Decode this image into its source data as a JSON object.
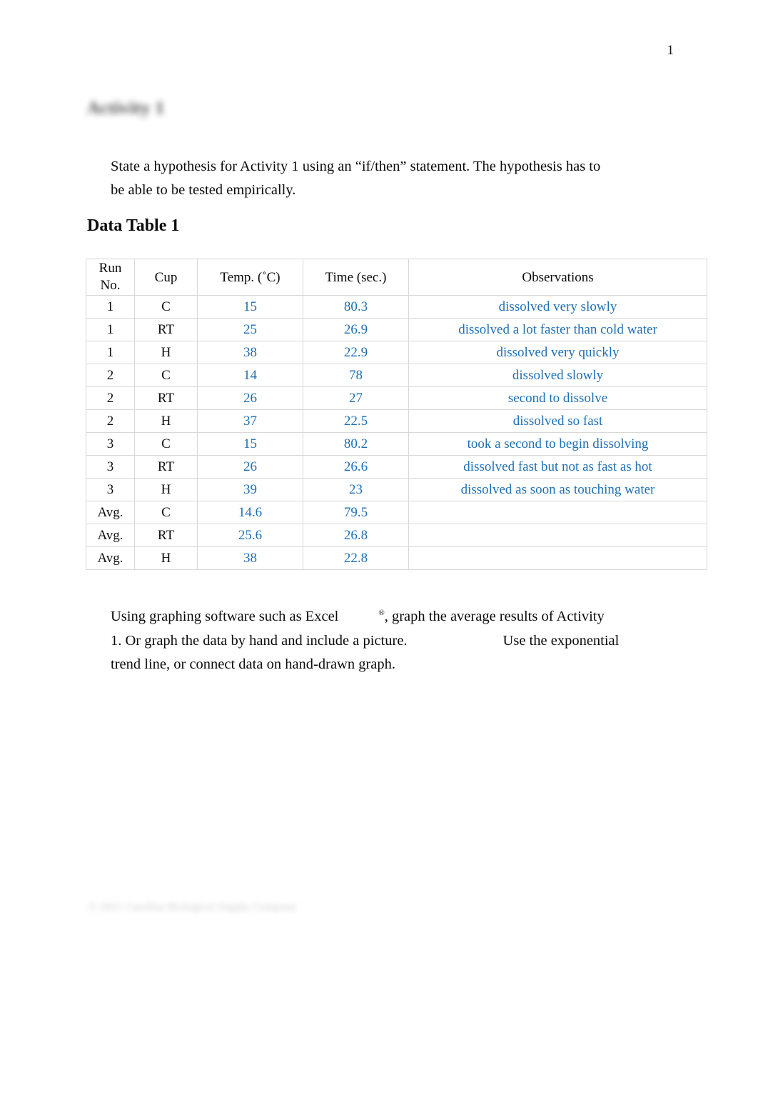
{
  "document": {
    "page_number": "1",
    "activity_title": "Activity 1",
    "hypothesis_text": "State a hypothesis for Activity 1 using an “if/then” statement. The hypothesis has to be able to be tested empirically.",
    "data_table_heading": "Data Table 1",
    "footer_note": "© 2021 Carolina Biological Supply Company",
    "accent_color": "#1f6fb5",
    "text_color": "#0b0b0b"
  },
  "instructions": {
    "line1_a": "Using graphing software such as Excel",
    "line1_sup": "®",
    "line1_b": ", graph the average results of Activity",
    "line2_a": "1. Or graph the data by hand and include a picture.",
    "line2_b": "Use the exponential",
    "line3": "trend line, or connect data on hand-drawn graph."
  },
  "table": {
    "headers": {
      "run_line1": "Run",
      "run_line2": "No.",
      "cup": "Cup",
      "temp": "Temp. (˚C)",
      "time": "Time (sec.)",
      "observations": "Observations"
    },
    "rows": [
      {
        "run": "1",
        "cup": "C",
        "temp": "15",
        "time": "80.3",
        "obs": "dissolved very slowly"
      },
      {
        "run": "1",
        "cup": "RT",
        "temp": "25",
        "time": "26.9",
        "obs": "dissolved a lot faster than cold water"
      },
      {
        "run": "1",
        "cup": "H",
        "temp": "38",
        "time": "22.9",
        "obs": "dissolved very quickly"
      },
      {
        "run": "2",
        "cup": "C",
        "temp": "14",
        "time": "78",
        "obs": "dissolved slowly"
      },
      {
        "run": "2",
        "cup": "RT",
        "temp": "26",
        "time": "27",
        "obs": "second to dissolve"
      },
      {
        "run": "2",
        "cup": "H",
        "temp": "37",
        "time": "22.5",
        "obs": "dissolved so fast"
      },
      {
        "run": "3",
        "cup": "C",
        "temp": "15",
        "time": "80.2",
        "obs": "took a second to begin dissolving"
      },
      {
        "run": "3",
        "cup": "RT",
        "temp": "26",
        "time": "26.6",
        "obs": "dissolved fast but not as fast as hot"
      },
      {
        "run": "3",
        "cup": "H",
        "temp": "39",
        "time": "23",
        "obs": "dissolved as soon as touching water"
      },
      {
        "run": "Avg.",
        "cup": "C",
        "temp": "14.6",
        "time": "79.5",
        "obs": ""
      },
      {
        "run": "Avg.",
        "cup": "RT",
        "temp": "25.6",
        "time": "26.8",
        "obs": ""
      },
      {
        "run": "Avg.",
        "cup": "H",
        "temp": "38",
        "time": "22.8",
        "obs": ""
      }
    ]
  },
  "chart_data": {
    "type": "table",
    "title": "Data Table 1",
    "columns": [
      "Run No.",
      "Cup",
      "Temp. (˚C)",
      "Time (sec.)",
      "Observations"
    ],
    "categories": [
      "C",
      "RT",
      "H"
    ],
    "series": [
      {
        "name": "Average Temp. (˚C)",
        "values": [
          14.6,
          25.6,
          38
        ]
      },
      {
        "name": "Average Time (sec.)",
        "values": [
          79.5,
          26.8,
          22.8
        ]
      }
    ],
    "xlabel": "Cup",
    "ylabel": "Temp. (˚C) / Time (sec.)"
  }
}
